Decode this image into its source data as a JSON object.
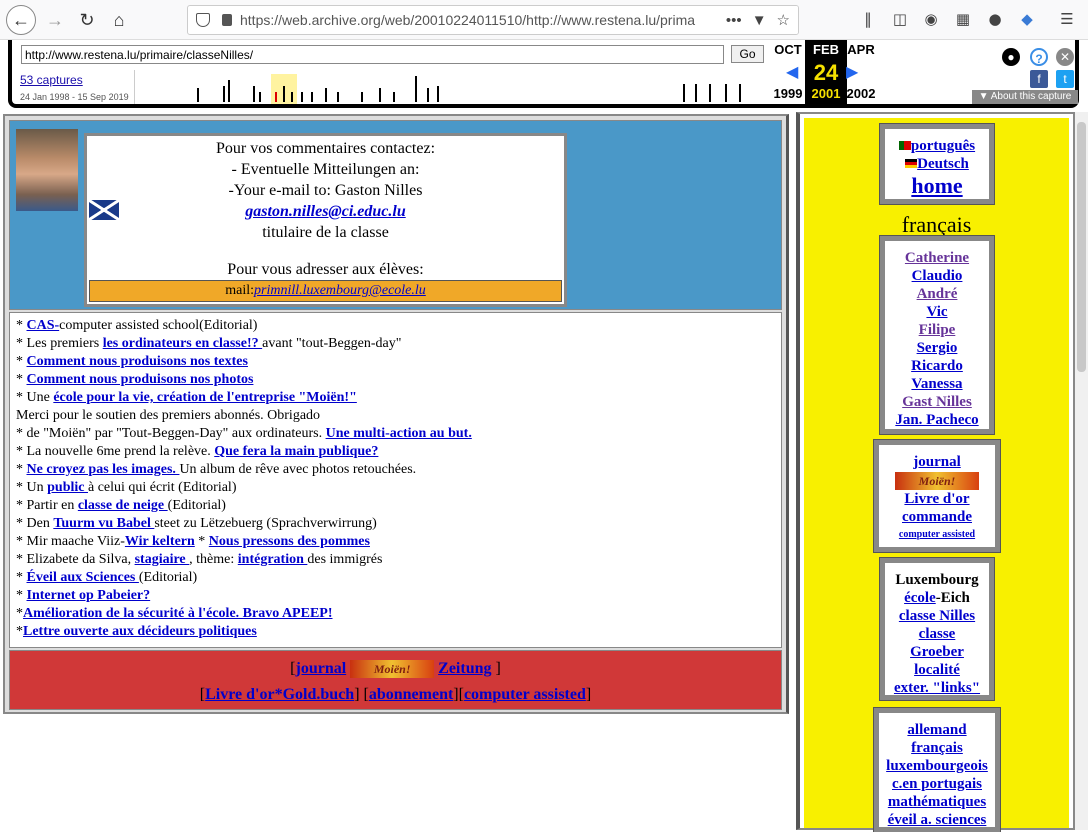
{
  "browser": {
    "url_host": "https://web.archive.org",
    "url_path": "/web/20010224011510/http://www.restena.lu/prima",
    "more": "•••"
  },
  "wayback": {
    "input_url": "http://www.restena.lu/primaire/classeNilles/",
    "go": "Go",
    "captures": "53 captures",
    "range": "24 Jan 1998 - 15 Sep 2019",
    "prev": {
      "month": "OCT",
      "year": "1999"
    },
    "cur": {
      "month": "FEB",
      "day": "24",
      "year": "2001"
    },
    "next": {
      "month": "APR",
      "year": "2002"
    },
    "about": "About this capture"
  },
  "contact": {
    "line1": "Pour vos commentaires contactez:",
    "line2": "- Eventuelle Mitteilungen an:",
    "line3": "-Your e-mail to: Gaston Nilles",
    "email": "gaston.nilles@ci.educ.lu",
    "role": "titulaire de la classe",
    "pupils": "Pour vous adresser aux élèves:",
    "mail_label": "mail:",
    "mail_link": "primnill.luxembourg@ecole.lu"
  },
  "list": [
    {
      "pre": " * ",
      "link": "CAS-",
      "post": "computer assisted school(Editorial)"
    },
    {
      "pre": "* Les premiers ",
      "link": "les ordinateurs en classe!? ",
      "post": "avant \"tout-Beggen-day\""
    },
    {
      "pre": "* ",
      "link": "Comment nous produisons nos textes",
      "post": ""
    },
    {
      "pre": "* ",
      "link": "Comment nous produisons nos photos",
      "post": ""
    },
    {
      "pre": "* Une ",
      "link": "école pour la vie, création de l'entreprise \"Moiën!\"",
      "post": ""
    },
    {
      "pre": "Merci pour le soutien des premiers abonnés. Obrigado",
      "link": "",
      "post": ""
    },
    {
      "pre": "* de \"Moiën\" par \"Tout-Beggen-Day\" aux ordinateurs. ",
      "link": "Une multi-action au but.",
      "post": ""
    },
    {
      "pre": "* La nouvelle 6me prend la relève. ",
      "link": "Que fera la main publique?",
      "post": ""
    },
    {
      "pre": "* ",
      "link": "Ne croyez pas les images. ",
      "post": "Un album de rêve avec photos retouchées."
    },
    {
      "pre": "* Un ",
      "link": "public ",
      "post": "à celui qui écrit (Editorial)"
    },
    {
      "pre": "* Partir en ",
      "link": "classe de neige ",
      "post": "(Editorial)"
    },
    {
      "pre": "* Den ",
      "link": "Tuurm vu Babel ",
      "post": "steet zu Lëtzebuerg (Sprachverwirrung)"
    },
    {
      "pre": "* Mir maache Viiz-",
      "link": "Wir keltern",
      "post": " * ",
      "link2": "Nous pressons des pommes"
    },
    {
      "pre": "* Elizabete da Silva, ",
      "link": "stagiaire ",
      "post": ", thème: ",
      "link2": "intégration ",
      "post2": "des immigrés"
    },
    {
      "pre": "* ",
      "link": "Éveil aux Sciences ",
      "post": "(Editorial)"
    },
    {
      "pre": "* ",
      "link": "Internet op Pabeier?",
      "post": ""
    },
    {
      "pre": "*",
      "link": "Amélioration de la sécurité à l'école. Bravo APEEP!",
      "post": ""
    },
    {
      "pre": "*",
      "link": "Lettre ouverte aux décideurs politiques",
      "post": ""
    }
  ],
  "footer": {
    "journal": "journal",
    "moien": "Moiën!",
    "zeitung": "Zeitung",
    "livre": "Livre  d'or*Gold.buch",
    "abo": "abonnement",
    "cas": "computer assisted"
  },
  "sidebar": {
    "lang1": "português",
    "lang2": "Deutsch",
    "home": "home",
    "francais": "français",
    "names": [
      "Catherine",
      "Claudio",
      "André",
      "Vic",
      "Filipe",
      "Sergio",
      "Ricardo",
      "Vanessa",
      "Gast Nilles",
      "Jan. Pacheco"
    ],
    "journal": "journal",
    "moien": "Moiën!",
    "livre": "Livre d'or",
    "commande": "commande",
    "cas": "computer assisted",
    "lux": "Luxembourg",
    "ecole": "école",
    "eich": "-Eich",
    "classe_nilles": "classe Nilles",
    "classe": "classe",
    "groeber": "Groeber",
    "localite": "localité",
    "exter": "exter. \"links\"",
    "subjects": [
      "allemand",
      "français",
      "luxembourgeois",
      "c.en portugais",
      "mathématiques",
      "éveil a. sciences"
    ]
  }
}
